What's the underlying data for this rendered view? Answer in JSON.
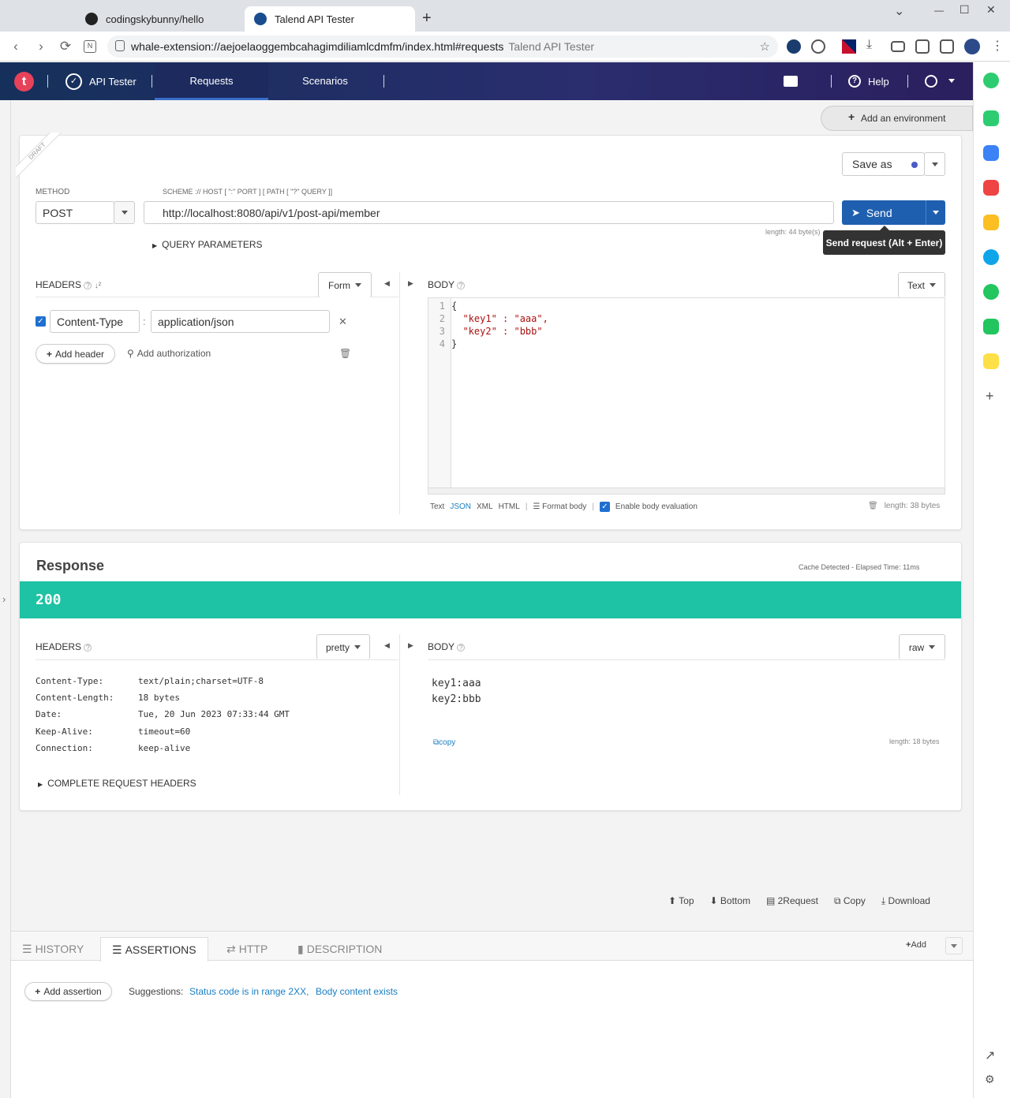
{
  "browser": {
    "tabs": [
      {
        "title": "codingskybunny/hello"
      },
      {
        "title": "Talend API Tester"
      }
    ],
    "new_tab": "+",
    "url": "whale-extension://aejoelaoggembcahagimdiliamlcdmfm/index.html#requests",
    "url_title": "Talend API Tester",
    "window_controls": {
      "chevron": "⌄",
      "minimize": "—",
      "maximize": "☐",
      "close": "✕"
    }
  },
  "app": {
    "logo": "t",
    "product": "API Tester",
    "nav": {
      "requests": "Requests",
      "scenarios": "Scenarios"
    },
    "help": "Help"
  },
  "environment": {
    "add_label": "Add an environment"
  },
  "request": {
    "draft": "DRAFT",
    "save_as": "Save as",
    "method_label": "METHOD",
    "method": "POST",
    "url_label": "SCHEME :// HOST [ \":\" PORT ] [ PATH [ \"?\" QUERY ]]",
    "url": "http://localhost:8080/api/v1/post-api/member",
    "length": "length: 44 byte(s)",
    "send": "Send",
    "send_tooltip": "Send request (Alt + Enter)",
    "query_params": "QUERY PARAMETERS",
    "headers_title": "HEADERS",
    "headers_mode": "Form",
    "headers": [
      {
        "key": "Content-Type",
        "value": "application/json",
        "enabled": true
      }
    ],
    "add_header": "Add header",
    "add_authorization": "Add authorization",
    "body_title": "BODY",
    "body_mode": "Text",
    "body_lines": [
      {
        "n": "1",
        "text": "{"
      },
      {
        "n": "2",
        "text": "  \"key1\" : \"aaa\","
      },
      {
        "n": "3",
        "text": "  \"key2\" : \"bbb\""
      },
      {
        "n": "4",
        "text": "}"
      }
    ],
    "body_formats": {
      "text": "Text",
      "json": "JSON",
      "xml": "XML",
      "html": "HTML"
    },
    "format_body": "Format body",
    "enable_eval": "Enable body evaluation",
    "body_length": "length: 38 bytes"
  },
  "response": {
    "title": "Response",
    "meta": "Cache Detected - Elapsed Time: 11ms",
    "status": "200",
    "headers_title": "HEADERS",
    "headers_mode": "pretty",
    "headers": [
      {
        "k": "Content-Type:",
        "v": "text/plain;charset=UTF-8"
      },
      {
        "k": "Content-Length:",
        "v": "18 bytes"
      },
      {
        "k": "Date:",
        "v": "Tue, 20 Jun 2023 07:33:44 GMT"
      },
      {
        "k": "Keep-Alive:",
        "v": "timeout=60"
      },
      {
        "k": "Connection:",
        "v": "keep-alive"
      }
    ],
    "complete_headers": "COMPLETE REQUEST HEADERS",
    "body_title": "BODY",
    "body_mode": "raw",
    "body_lines": [
      "key1:aaa",
      "key2:bbb"
    ],
    "copy": "copy",
    "length": "length: 18 bytes"
  },
  "footer_actions": {
    "top": "Top",
    "bottom": "Bottom",
    "to_request": "2Request",
    "copy": "Copy",
    "download": "Download"
  },
  "bottom_panel": {
    "tabs": {
      "history": "HISTORY",
      "assertions": "ASSERTIONS",
      "http": "HTTP",
      "description": "DESCRIPTION"
    },
    "add": "Add",
    "add_assertion": "Add assertion",
    "suggestions_label": "Suggestions:",
    "suggestions": [
      "Status code is in range 2XX,",
      "Body content exists"
    ]
  },
  "colors": {
    "status_ok": "#1ec2a4",
    "send": "#1f5fb0",
    "logo": "#e8425a"
  }
}
